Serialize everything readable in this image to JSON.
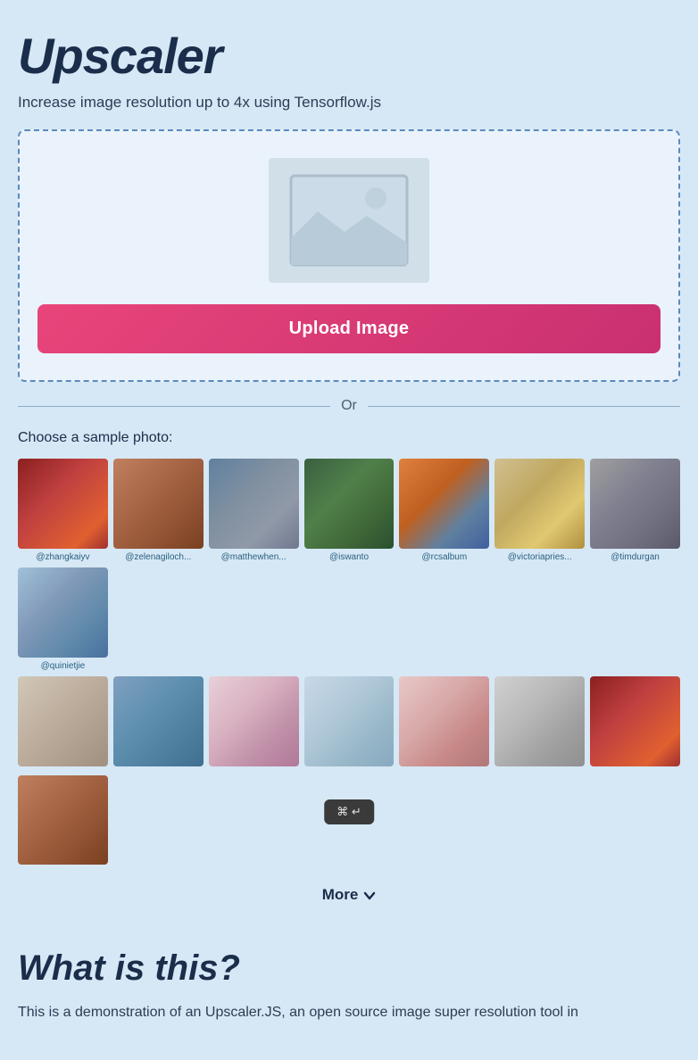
{
  "header": {
    "title": "Upscaler",
    "subtitle": "Increase image resolution up to 4x using Tensorflow.js"
  },
  "upload": {
    "button_label": "Upload Image"
  },
  "divider": {
    "label": "Or"
  },
  "samples": {
    "section_label": "Choose a sample photo:",
    "more_button": "More",
    "row1": [
      {
        "username": "@zhangkaiyv",
        "thumb_class": "sample-thumb-1"
      },
      {
        "username": "@zelenagiloch...",
        "thumb_class": "sample-thumb-2"
      },
      {
        "username": "@matthewhen...",
        "thumb_class": "sample-thumb-3"
      },
      {
        "username": "@iswanto",
        "thumb_class": "sample-thumb-4"
      },
      {
        "username": "@rcsalbum",
        "thumb_class": "sample-thumb-5"
      },
      {
        "username": "@victoriapries...",
        "thumb_class": "sample-thumb-6"
      },
      {
        "username": "@timdurgan",
        "thumb_class": "sample-thumb-7"
      },
      {
        "username": "@quinietjie",
        "thumb_class": "sample-thumb-8"
      }
    ],
    "row2": [
      {
        "username": "",
        "thumb_class": "sample-thumb-9"
      },
      {
        "username": "",
        "thumb_class": "sample-thumb-10"
      },
      {
        "username": "",
        "thumb_class": "sample-thumb-11"
      },
      {
        "username": "",
        "thumb_class": "sample-thumb-12"
      },
      {
        "username": "",
        "thumb_class": "sample-thumb-13"
      },
      {
        "username": "",
        "thumb_class": "sample-thumb-14"
      },
      {
        "username": "",
        "thumb_class": "sample-thumb-1"
      },
      {
        "username": "",
        "thumb_class": "sample-thumb-2"
      }
    ]
  },
  "what_section": {
    "title": "What is this?",
    "description": "This is a demonstration of an Upscaler.JS, an open source image super resolution tool in"
  },
  "keyboard_shortcut": {
    "label": "⌘ ↵"
  }
}
